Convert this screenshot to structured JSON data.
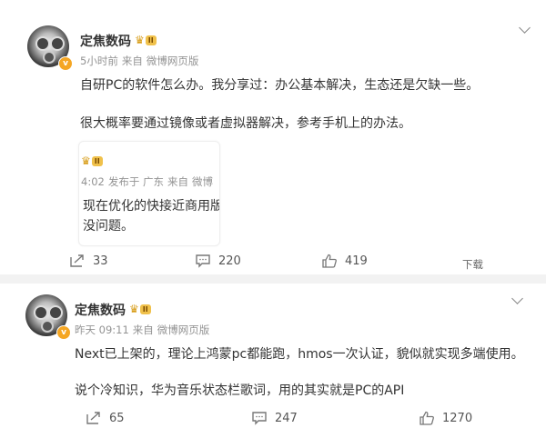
{
  "posts": [
    {
      "author": "定焦数码",
      "level": "II",
      "verified_mark": "v",
      "time": "5小时前",
      "source_prefix": "来自",
      "source": "微博网页版",
      "line1": "自研PC的软件怎么办。我分享过：办公基本解决，生态还是欠缺一些。",
      "line2": "很大概率要通过镜像或者虚拟器解决，参考手机上的办法。",
      "quote": {
        "level": "II",
        "meta_time": "4:02",
        "meta_loc": "发布于 广东",
        "meta_src_prefix": "来自",
        "meta_src": "微博",
        "line1": "现在优化的快接近商用版",
        "line2": "没问题。"
      },
      "actions": {
        "repost": "33",
        "comment": "220",
        "like": "419",
        "download": "下载"
      }
    },
    {
      "author": "定焦数码",
      "level": "II",
      "verified_mark": "v",
      "time": "昨天 09:11",
      "source_prefix": "来自",
      "source": "微博网页版",
      "line1": "Next已上架的，理论上鸿蒙pc都能跑，hmos一次认证，貌似就实现多端使用。",
      "line2": "说个冷知识，华为音乐状态栏歌词，用的其实就是PC的API",
      "actions": {
        "repost": "65",
        "comment": "247",
        "like": "1270"
      }
    }
  ],
  "colors": {
    "meta": "#939393",
    "text": "#333333",
    "crown": "#d79b14",
    "badge": "#f5a623",
    "background": "#f2f2f2"
  },
  "icons": [
    "repost-icon",
    "comment-icon",
    "like-icon",
    "chevron-down-icon",
    "crown-icon",
    "verified-badge-icon"
  ]
}
